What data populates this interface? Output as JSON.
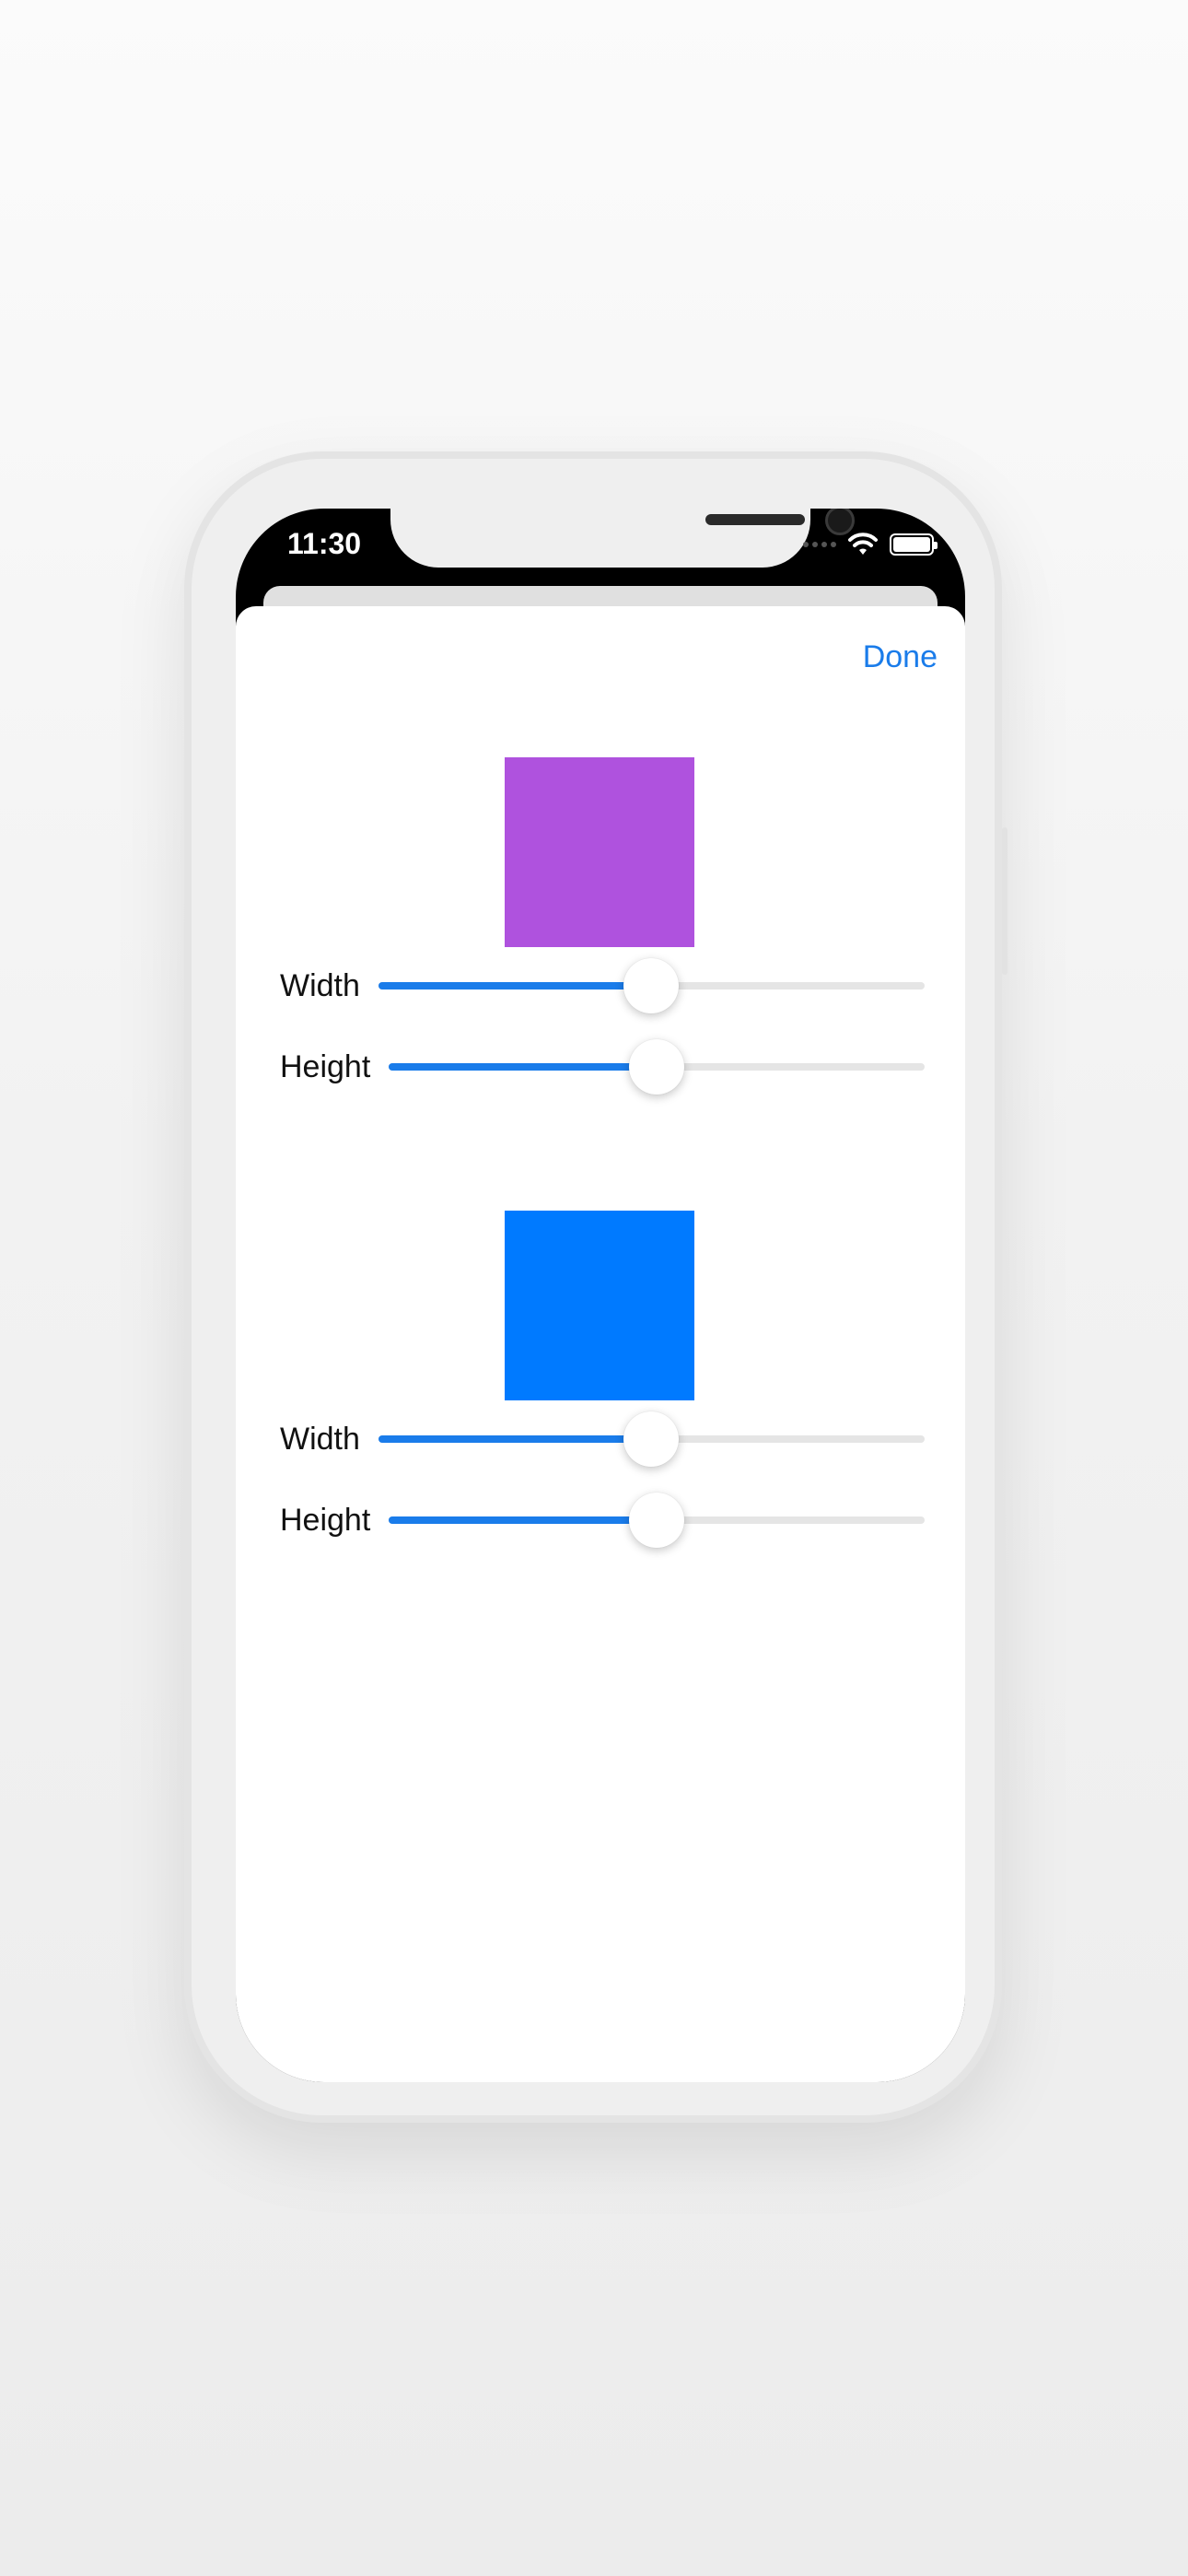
{
  "status_bar": {
    "time": "11:30",
    "wifi_icon": "wifi-icon",
    "battery_icon": "battery-icon"
  },
  "toolbar": {
    "done_label": "Done",
    "accent_color": "#1a7cea"
  },
  "shapes": [
    {
      "color": "#af52de",
      "sliders": [
        {
          "label": "Width",
          "value": 0.5
        },
        {
          "label": "Height",
          "value": 0.5
        }
      ]
    },
    {
      "color": "#007aff",
      "sliders": [
        {
          "label": "Width",
          "value": 0.5
        },
        {
          "label": "Height",
          "value": 0.5
        }
      ]
    }
  ]
}
